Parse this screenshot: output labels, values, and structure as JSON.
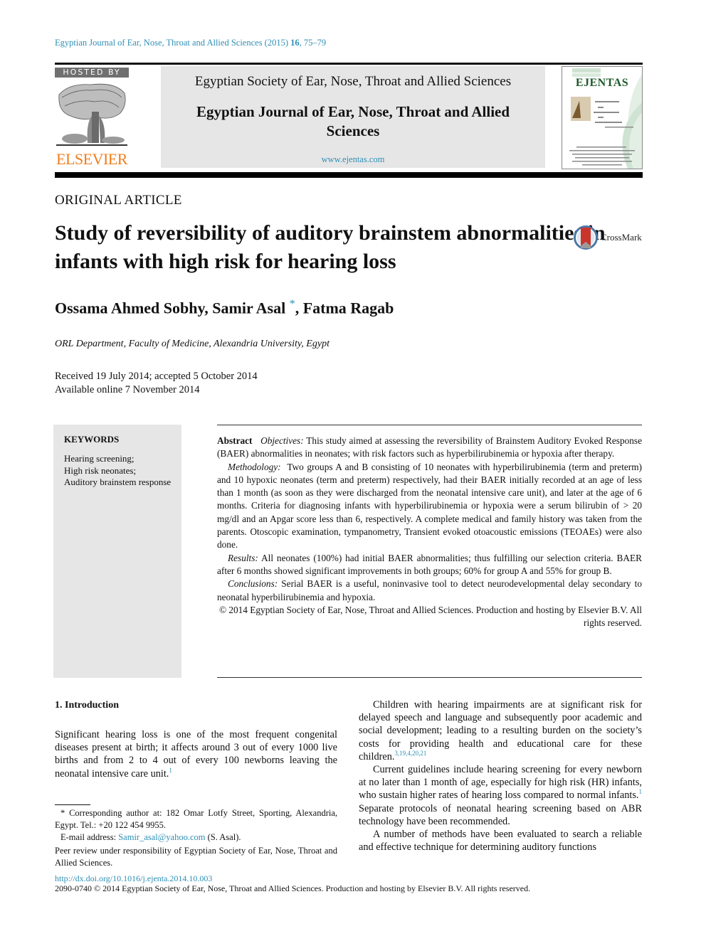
{
  "citation": {
    "journal": "Egyptian Journal of Ear, Nose, Throat and Allied Sciences (2015)",
    "volume": "16",
    "pages": ", 75–79"
  },
  "header": {
    "hosted_by": "HOSTED BY",
    "publisher_logo_text": "ELSEVIER",
    "society": "Egyptian Society of Ear, Nose, Throat and Allied Sciences",
    "journal_name": "Egyptian Journal of Ear, Nose, Throat and Allied Sciences",
    "journal_url": "www.ejentas.com",
    "cover_title": "EJENTAS"
  },
  "article": {
    "type": "ORIGINAL ARTICLE",
    "title": "Study of reversibility of auditory brainstem abnormalities in infants with high risk for hearing loss",
    "crossmark_label": "CrossMark",
    "authors": [
      "Ossama Ahmed Sobhy",
      "Samir Asal",
      "Fatma Ragab"
    ],
    "corresponding_mark": "*",
    "affiliation": "ORL Department, Faculty of Medicine, Alexandria University, Egypt",
    "received": "Received 19 July 2014; accepted 5 October 2014",
    "available_online": "Available online 7 November 2014"
  },
  "keywords": {
    "title": "KEYWORDS",
    "items": [
      "Hearing screening;",
      "High risk neonates;",
      "Auditory brainstem response"
    ]
  },
  "abstract": {
    "label": "Abstract",
    "sections": [
      {
        "label": "Objectives:",
        "text": "This study aimed at assessing the reversibility of Brainstem Auditory Evoked Response (BAER) abnormalities in neonates; with risk factors such as hyperbilirubinemia or hypoxia after therapy."
      },
      {
        "label": "Methodology:",
        "text": "Two groups A and B consisting of 10 neonates with hyperbilirubinemia (term and preterm) and 10 hypoxic neonates (term and preterm) respectively, had their BAER initially recorded at an age of less than 1 month (as soon as they were discharged from the neonatal intensive care unit), and later at the age of 6 months. Criteria for diagnosing infants with hyperbilirubinemia or hypoxia were a serum bilirubin of  > 20 mg/dl and an Apgar score less than 6, respectively. A complete medical and family history was taken from the parents. Otoscopic examination, tympanometry, Transient evoked otoacoustic emissions (TEOAEs) were also done."
      },
      {
        "label": "Results:",
        "text": "All neonates (100%) had initial BAER abnormalities; thus fulfilling our selection criteria. BAER after 6 months showed significant improvements in both groups; 60% for group A and 55% for group B."
      },
      {
        "label": "Conclusions:",
        "text": "Serial BAER is a useful, noninvasive tool to detect neurodevelopmental delay secondary to neonatal hyperbilirubinemia and hypoxia."
      }
    ],
    "copyright": "© 2014 Egyptian Society of Ear, Nose, Throat and Allied Sciences. Production and hosting by Elsevier B.V. All rights reserved."
  },
  "introduction": {
    "heading": "1. Introduction",
    "p1": "Significant hearing loss is one of the most frequent congenital diseases present at birth; it affects around 3 out of every 1000 live births and from 2 to 4 out of every 100 newborns leaving the neonatal intensive care unit.",
    "p1_ref": "1",
    "p2": "Children with hearing impairments are at significant risk for delayed speech and language and subsequently poor academic and social development; leading to a resulting burden on the society’s costs for providing health and educational care for these children.",
    "p2_ref": "3,19,4,20,21",
    "p3a": "Current guidelines include hearing screening for every newborn at no later than 1 month of age, especially for high risk (HR) infants, who sustain higher rates of hearing loss compared to normal infants.",
    "p3_ref": "1",
    "p3b": " Separate protocols of neonatal hearing screening based on ABR technology have been recommended.",
    "p4": "A number of methods have been evaluated to search a reliable and effective technique for determining auditory functions"
  },
  "footnotes": {
    "corresponding": "* Corresponding author at: 182 Omar Lotfy Street, Sporting, Alexandria, Egypt. Tel.: +20 122 454 9955.",
    "email_label": "E-mail address:",
    "email": "Samir_asal@yahoo.com",
    "email_suffix": "(S. Asal).",
    "peer_review": "Peer review under responsibility of Egyptian Society of Ear, Nose, Throat and Allied Sciences."
  },
  "footer": {
    "doi": "http://dx.doi.org/10.1016/j.ejenta.2014.10.003",
    "issn_copyright": "2090-0740 © 2014 Egyptian Society of Ear, Nose, Throat and Allied Sciences. Production and hosting by Elsevier B.V. All rights reserved."
  },
  "colors": {
    "link": "#2f8fb5",
    "elsevier_orange": "#f07d1a",
    "header_gray": "#e6e6e6",
    "cover_green": "#1e5a2b"
  }
}
